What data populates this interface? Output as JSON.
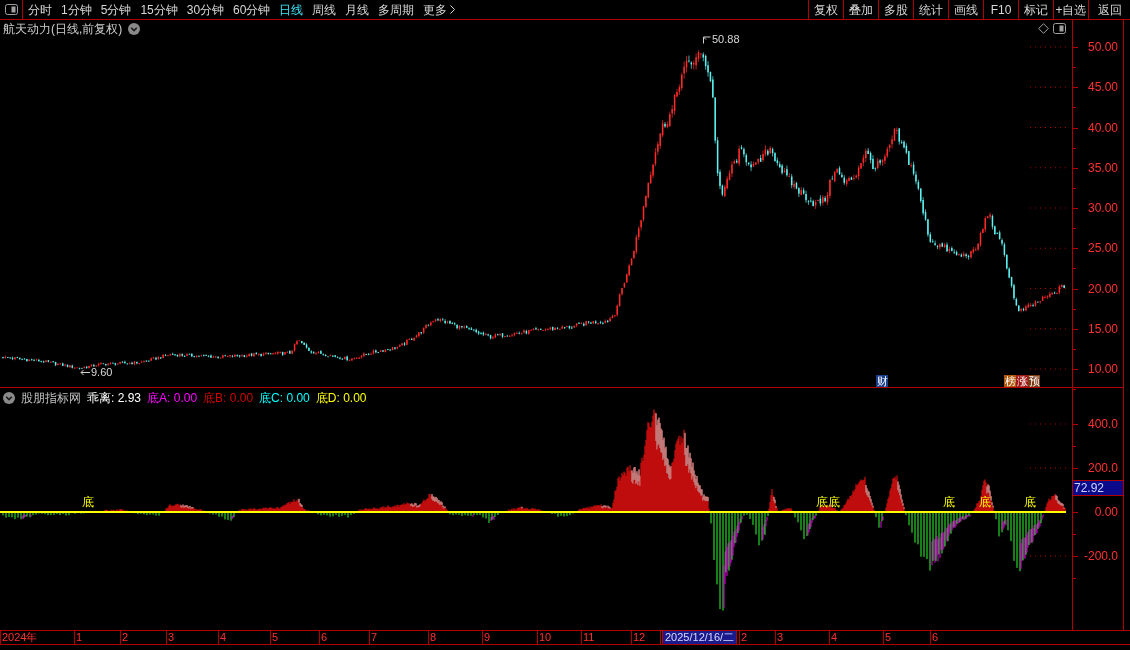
{
  "toolbar": {
    "period_tabs": [
      {
        "label": "分时",
        "selected": false,
        "kind": "period"
      },
      {
        "label": "1分钟",
        "selected": false,
        "kind": "period"
      },
      {
        "label": "5分钟",
        "selected": false,
        "kind": "period"
      },
      {
        "label": "15分钟",
        "selected": false,
        "kind": "period"
      },
      {
        "label": "30分钟",
        "selected": false,
        "kind": "period"
      },
      {
        "label": "60分钟",
        "selected": false,
        "kind": "period"
      },
      {
        "label": "日线",
        "selected": true,
        "kind": "period"
      },
      {
        "label": "周线",
        "selected": false,
        "kind": "period"
      },
      {
        "label": "月线",
        "selected": false,
        "kind": "period"
      },
      {
        "label": "多周期",
        "selected": false,
        "kind": "period"
      },
      {
        "label": "更多",
        "selected": false,
        "kind": "menu"
      }
    ],
    "buttons": [
      "复权",
      "叠加",
      "多股",
      "统计",
      "画线",
      "F10",
      "标记",
      "+自选",
      "返回"
    ]
  },
  "price_panel": {
    "title": "航天动力(日线,前复权)",
    "high_label": "50.88",
    "low_label": "9.60",
    "event_markers": [
      {
        "label": "财",
        "color": "#1c3f8c"
      },
      {
        "label": "榜",
        "color": "#b0580c"
      },
      {
        "label": "涨",
        "color": "#a01818"
      },
      {
        "label": "预",
        "color": "#7a3a16"
      }
    ],
    "axis_ticks": [
      "50.00",
      "45.00",
      "40.00",
      "35.00",
      "30.00",
      "25.00",
      "20.00",
      "15.00",
      "10.00"
    ]
  },
  "indicator_panel": {
    "name": "股朋指标网",
    "readings": [
      {
        "text": "乖离: 2.93",
        "color": "#ffffff"
      },
      {
        "text": "底A: 0.00",
        "color": "#ff00ff"
      },
      {
        "text": "底B: 0.00",
        "color": "#d00000"
      },
      {
        "text": "底C: 0.00",
        "color": "#00ffff"
      },
      {
        "text": "底D: 0.00",
        "color": "#ffff00"
      }
    ],
    "bottom_signals": [
      "底",
      "底",
      "底",
      "底",
      "底",
      "底"
    ],
    "axis_ticks": [
      "400.0",
      "200.0",
      "0.00",
      "-200.0"
    ],
    "cursor_value": "72.92"
  },
  "time_axis": {
    "labels": [
      {
        "text": "2024年",
        "kind": "tick"
      },
      {
        "text": "1",
        "kind": "tick"
      },
      {
        "text": "2",
        "kind": "tick"
      },
      {
        "text": "3",
        "kind": "tick"
      },
      {
        "text": "4",
        "kind": "tick"
      },
      {
        "text": "5",
        "kind": "tick"
      },
      {
        "text": "6",
        "kind": "tick"
      },
      {
        "text": "7",
        "kind": "tick"
      },
      {
        "text": "8",
        "kind": "tick"
      },
      {
        "text": "9",
        "kind": "tick"
      },
      {
        "text": "10",
        "kind": "tick"
      },
      {
        "text": "11",
        "kind": "tick"
      },
      {
        "text": "12",
        "kind": "tick"
      },
      {
        "text": "2025/12/16/二",
        "kind": "cursor"
      },
      {
        "text": "2",
        "kind": "tick"
      },
      {
        "text": "3",
        "kind": "tick"
      },
      {
        "text": "4",
        "kind": "tick"
      },
      {
        "text": "5",
        "kind": "tick"
      },
      {
        "text": "6",
        "kind": "tick"
      }
    ]
  }
}
